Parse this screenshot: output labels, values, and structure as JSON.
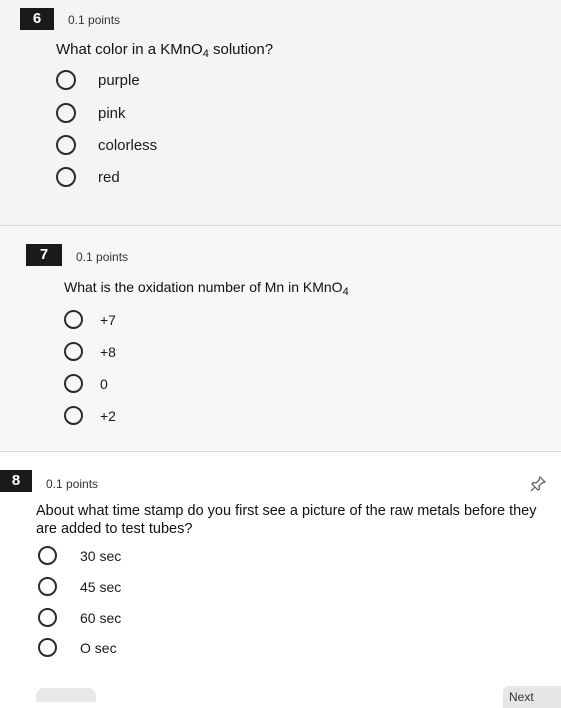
{
  "questions": [
    {
      "number": "6",
      "points": "0.1 points",
      "text_before": "What color in a KMnO",
      "subscript": "4",
      "text_after": " solution?",
      "options": [
        "purple",
        "pink",
        "colorless",
        "red"
      ]
    },
    {
      "number": "7",
      "points": "0.1 points",
      "text_before": "What is the oxidation number of Mn in KMnO",
      "subscript": "4",
      "text_after": "",
      "options": [
        "+7",
        "+8",
        "0",
        "+2"
      ]
    },
    {
      "number": "8",
      "points": "0.1 points",
      "text_line1": "About what time stamp do you first see a picture of the raw metals before they",
      "text_line2": "are added to test tubes?",
      "options": [
        "30 sec",
        "45 sec",
        "60 sec",
        "O sec"
      ]
    }
  ],
  "icons": {
    "flag": "pin-icon"
  },
  "navigation": {
    "next_label": "Next"
  }
}
